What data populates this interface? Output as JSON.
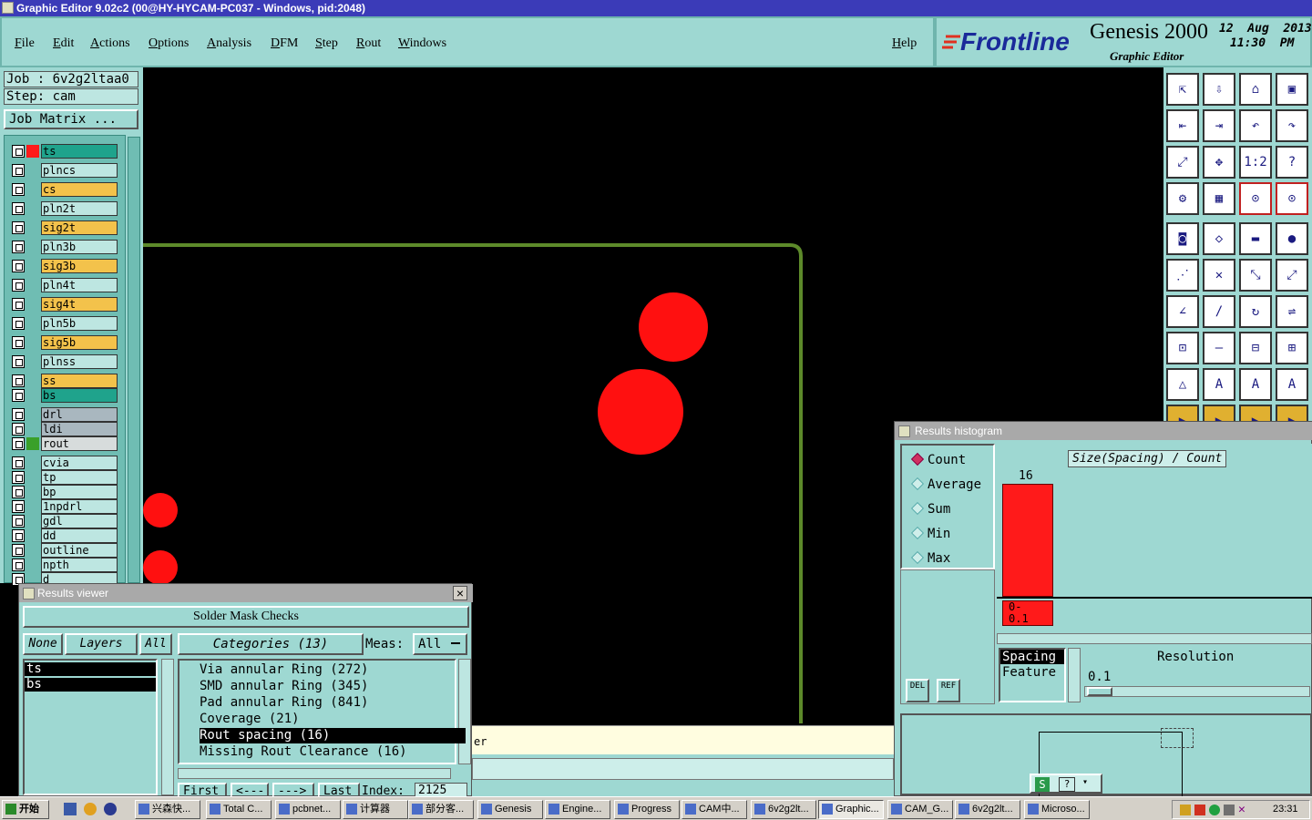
{
  "window": {
    "title": "Graphic Editor 9.02c2 (00@HY-HYCAM-PC037 - Windows, pid:2048)"
  },
  "menu": [
    "File",
    "Edit",
    "Actions",
    "Options",
    "Analysis",
    "DFM",
    "Step",
    "Rout",
    "Windows"
  ],
  "help_label": "Help",
  "brand": {
    "logo": "Frontline",
    "product": "Genesis 2000",
    "subtitle": "Graphic Editor",
    "date": "12  Aug  2013",
    "time": "11:30  PM"
  },
  "job": {
    "job_line": "Job  :  6v2g2ltaa0",
    "step_line": "Step:  cam",
    "matrix_button": "Job Matrix ..."
  },
  "layers": [
    {
      "name": "ts",
      "color": "#1fa38c"
    },
    {
      "name": "plncs",
      "color": "#bde6e1"
    },
    {
      "name": "cs",
      "color": "#f3c24b"
    },
    {
      "name": "pln2t",
      "color": "#bde6e1"
    },
    {
      "name": "sig2t",
      "color": "#f3c24b"
    },
    {
      "name": "pln3b",
      "color": "#bde6e1"
    },
    {
      "name": "sig3b",
      "color": "#f3c24b"
    },
    {
      "name": "pln4t",
      "color": "#bde6e1"
    },
    {
      "name": "sig4t",
      "color": "#f3c24b"
    },
    {
      "name": "pln5b",
      "color": "#bde6e1"
    },
    {
      "name": "sig5b",
      "color": "#f3c24b"
    },
    {
      "name": "plnss",
      "color": "#bde6e1"
    },
    {
      "name": "ss",
      "color": "#f3c24b"
    },
    {
      "name": "bs",
      "color": "#1fa38c"
    },
    {
      "name": "drl",
      "color": "#a9b7bf"
    },
    {
      "name": "ldi",
      "color": "#a9b7bf"
    },
    {
      "name": "rout",
      "color": "#d7dcdc"
    },
    {
      "name": "cvia",
      "color": "#bde6e1"
    },
    {
      "name": "tp",
      "color": "#bde6e1"
    },
    {
      "name": "bp",
      "color": "#bde6e1"
    },
    {
      "name": "1npdrl",
      "color": "#bde6e1"
    },
    {
      "name": "gdl",
      "color": "#bde6e1"
    },
    {
      "name": "dd",
      "color": "#bde6e1"
    },
    {
      "name": "outline",
      "color": "#bde6e1"
    },
    {
      "name": "npth",
      "color": "#bde6e1"
    },
    {
      "name": "d",
      "color": "#bde6e1"
    }
  ],
  "histogram": {
    "title": "Results histogram",
    "modes": [
      "Count",
      "Average",
      "Sum",
      "Min",
      "Max"
    ],
    "selected_mode": "Count",
    "chart_title": "Size(Spacing) / Count",
    "bar_value": "16",
    "bar_range": "0-\n0.1",
    "del_label": "DEL",
    "ref_label": "REF",
    "list_items": [
      "Spacing",
      "Feature"
    ],
    "resolution_label": "Resolution",
    "resolution_value": "0.1"
  },
  "results_viewer": {
    "title": "Results viewer",
    "header": "Solder Mask Checks",
    "none_btn": "None",
    "layers_btn": "Layers",
    "all_btn": "All",
    "categories_btn": "Categories (13)",
    "meas_label": "Meas:",
    "meas_value": "All",
    "layers": [
      "ts",
      "bs"
    ],
    "categories": [
      "Via annular Ring (272)",
      "SMD annular Ring (345)",
      "Pad annular Ring (841)",
      "Coverage (21)",
      "Rout spacing (16)",
      "Missing Rout Clearance (16)"
    ],
    "selected_category": "Rout spacing (16)",
    "first_btn": "First",
    "prev_btn": "<---",
    "next_btn": "--->",
    "last_btn": "Last",
    "index_label": "Index:",
    "index_value": "2125"
  },
  "status_fragment": "er",
  "taskbar": {
    "start": "开始",
    "tasks": [
      "兴森快...",
      "Total C...",
      "pcbnet...",
      "计算器",
      "部分客...",
      "Genesis",
      "Engine...",
      "Progress",
      "CAM中...",
      "6v2g2lt...",
      "Graphic...",
      "CAM_G...",
      "6v2g2lt...",
      "Microso..."
    ],
    "active": "Graphic...",
    "clock": "23:31"
  }
}
